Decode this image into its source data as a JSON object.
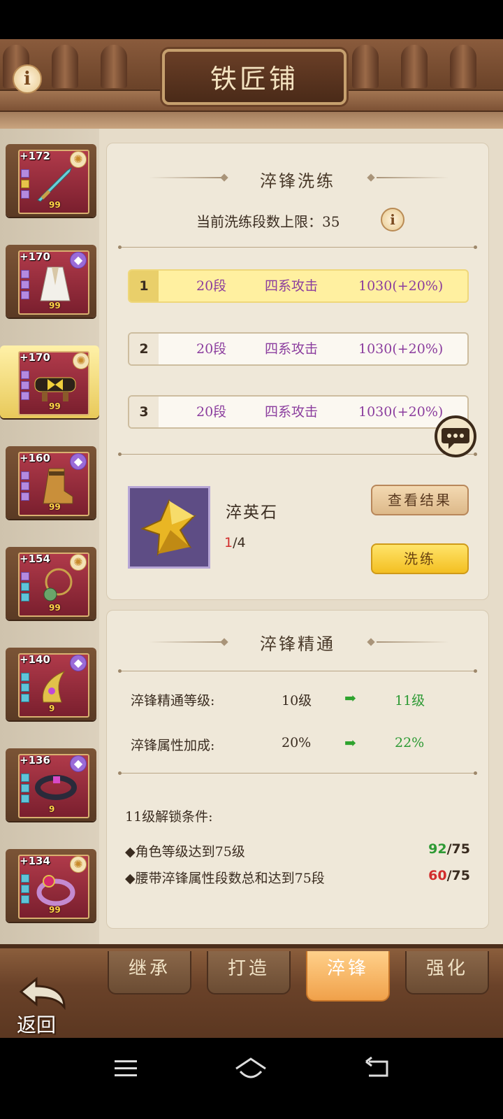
{
  "header": {
    "title": "铁匠铺",
    "info_icon": "info-icon"
  },
  "equipment_list": [
    {
      "level": "+172",
      "count": "99",
      "item": "sword",
      "badge": "sun"
    },
    {
      "level": "+170",
      "count": "99",
      "item": "robe",
      "badge": "purple"
    },
    {
      "level": "+170",
      "count": "99",
      "item": "belt",
      "badge": "sun",
      "selected": true
    },
    {
      "level": "+160",
      "count": "99",
      "item": "boots",
      "badge": "purple"
    },
    {
      "level": "+154",
      "count": "99",
      "item": "necklace",
      "badge": "sun"
    },
    {
      "level": "+140",
      "count": "9",
      "item": "horn-ornament",
      "badge": "purple"
    },
    {
      "level": "+136",
      "count": "9",
      "item": "bracer",
      "badge": "purple"
    },
    {
      "level": "+134",
      "count": "99",
      "item": "ring",
      "badge": "sun"
    }
  ],
  "refine": {
    "title": "淬锋洗练",
    "cap_label": "当前洗练段数上限：35",
    "rows": [
      {
        "index": "1",
        "segments": "20段",
        "attribute": "四系攻击",
        "value": "1030(+20%)",
        "active": true
      },
      {
        "index": "2",
        "segments": "20段",
        "attribute": "四系攻击",
        "value": "1030(+20%)"
      },
      {
        "index": "3",
        "segments": "20段",
        "attribute": "四系攻击",
        "value": "1030(+20%)"
      }
    ],
    "material": {
      "name": "淬英石",
      "have": "1",
      "need": "/4"
    },
    "view_button": "查看结果",
    "refine_button": "洗练"
  },
  "mastery": {
    "title": "淬锋精通",
    "stats": [
      {
        "label": "淬锋精通等级:",
        "from": "10级",
        "to": "11级"
      },
      {
        "label": "淬锋属性加成:",
        "from": "20%",
        "to": "22%"
      }
    ],
    "unlock_title": "11级解锁条件:",
    "conditions": [
      {
        "text": "◆角色等级达到75级",
        "current": "92",
        "target": "/75",
        "met": true
      },
      {
        "text": "◆腰带淬锋属性段数总和达到75段",
        "current": "60",
        "target": "/75",
        "met": false
      }
    ]
  },
  "tabs": [
    "继承",
    "打造",
    "淬锋",
    "强化"
  ],
  "active_tab": "淬锋",
  "back_label": "返回",
  "colors": {
    "accent_gold": "#f3bf22",
    "attr_purple": "#8b3d9e",
    "good_green": "#2e9a35",
    "bad_red": "#d22d2d"
  }
}
